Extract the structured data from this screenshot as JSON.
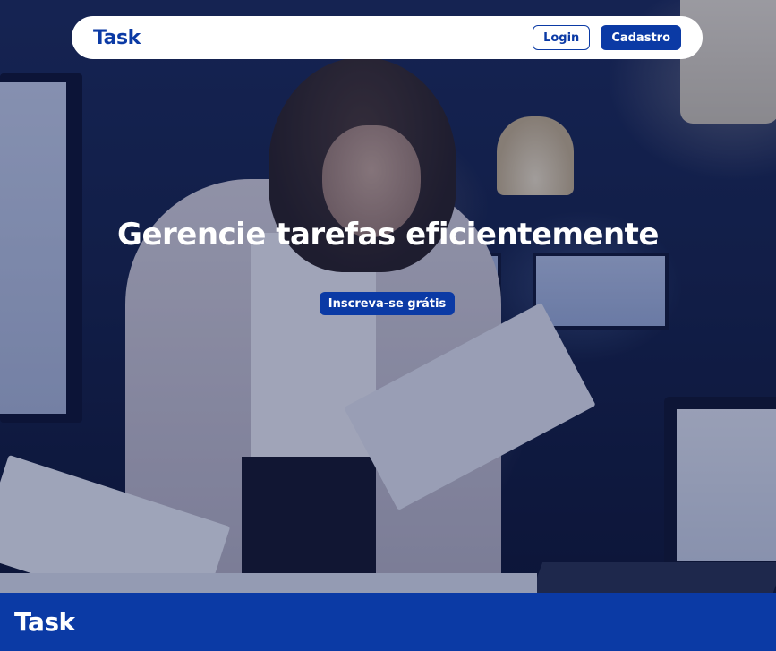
{
  "nav": {
    "brand": "Task",
    "login_label": "Login",
    "signup_label": "Cadastro"
  },
  "hero": {
    "title": "Gerencie tarefas eficientemente",
    "cta_label": "Inscreva-se grátis"
  },
  "footer": {
    "brand": "Task"
  },
  "colors": {
    "brand_blue": "#0b3aa5",
    "nav_background": "#ffffff",
    "hero_text": "#ffffff"
  }
}
